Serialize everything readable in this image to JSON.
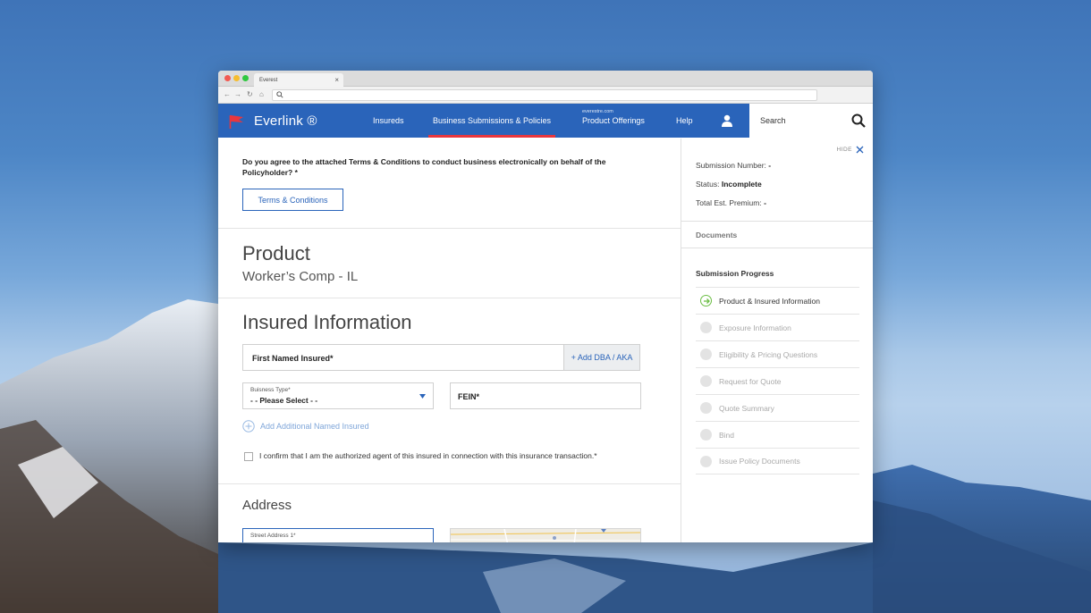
{
  "browser": {
    "tab_title": "Everest",
    "tab_close": "×"
  },
  "header": {
    "brand": "Everlink ®",
    "nav": [
      {
        "label": "Insureds"
      },
      {
        "label": "Business Submissions & Policies",
        "active": true
      },
      {
        "label": "Product Offerings",
        "sub": "everestre.com"
      },
      {
        "label": "Help"
      }
    ],
    "search_label": "Search"
  },
  "main": {
    "terms_question": "Do you agree to the attached Terms & Conditions to conduct business electronically on behalf of the Policyholder? *",
    "terms_button": "Terms & Conditions",
    "product_heading": "Product",
    "product_value": "Worker’s Comp - IL",
    "insured_heading": "Insured Information",
    "first_named_insured": "First Named Insured*",
    "add_dba": "+ Add DBA / AKA",
    "business_type_label": "Buisness Type*",
    "business_type_value": "- - Please Select - -",
    "fein": "FEIN*",
    "add_named_insured": "Add Additional Named Insured",
    "confirm_text": "I confirm that I am the authorized agent of this insured in connection with this insurance transaction.*",
    "address_heading": "Address",
    "street_address_label": "Street Address 1*"
  },
  "panel": {
    "hide_label": "HIDE",
    "submission_number_label": "Submission Number:",
    "submission_number_value": "-",
    "status_label": "Status:",
    "status_value": "Incomplete",
    "premium_label": "Total Est. Premium:",
    "premium_value": "-",
    "documents_label": "Documents",
    "progress_title": "Submission Progress",
    "steps": [
      {
        "label": "Product & Insured Information",
        "active": true
      },
      {
        "label": "Exposure Information"
      },
      {
        "label": "Eligibility & Pricing Questions"
      },
      {
        "label": "Request for Quote"
      },
      {
        "label": "Quote Summary"
      },
      {
        "label": "Bind"
      },
      {
        "label": "Issue Policy Documents"
      }
    ]
  },
  "colors": {
    "brand_blue": "#2a64ba",
    "active_underline": "#e8363d",
    "progress_green": "#6cbe45"
  }
}
